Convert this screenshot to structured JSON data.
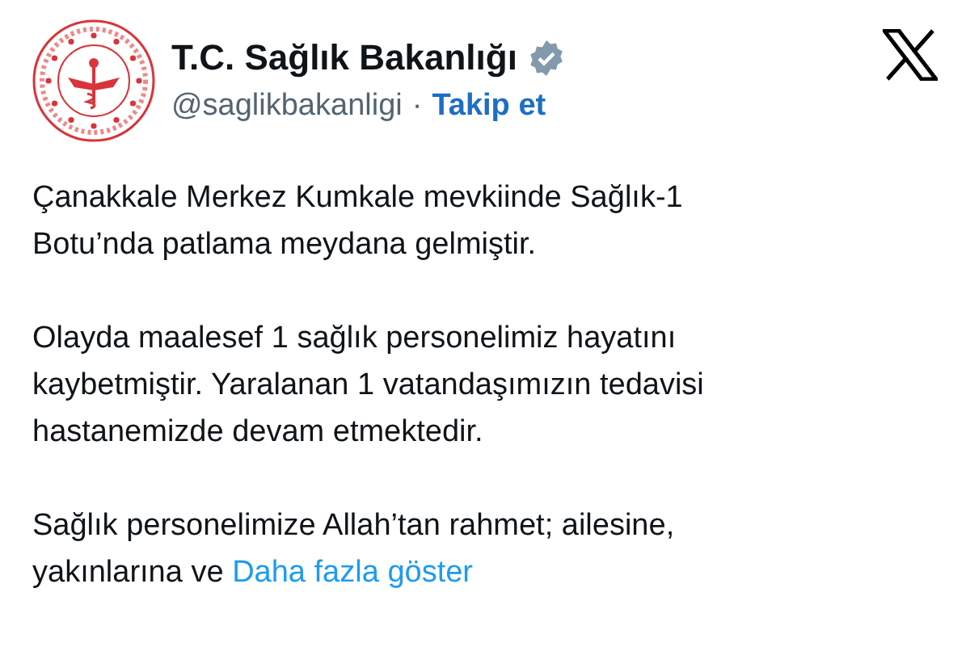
{
  "account": {
    "name": "T.C. Sağlık Bakanlığı",
    "verified": true,
    "handle": "@saglikbakanligi",
    "separator": "·",
    "follow": "Takip et"
  },
  "paragraphs": [
    {
      "lines": [
        "Çanakkale Merkez Kumkale mevkiinde Sağlık-1",
        "Botu’nda patlama meydana gelmiştir."
      ]
    },
    {
      "lines": [
        "Olayda maalesef 1 sağlık personelimiz hayatını",
        "kaybetmiştir. Yaralanan 1 vatandaşımızın tedavisi",
        "hastanemizde devam etmektedir."
      ]
    },
    {
      "lines": [
        "Sağlık personelimize Allah’tan rahmet; ailesine,",
        "yakınlarına ve"
      ],
      "more": "Daha fazla göster"
    }
  ]
}
